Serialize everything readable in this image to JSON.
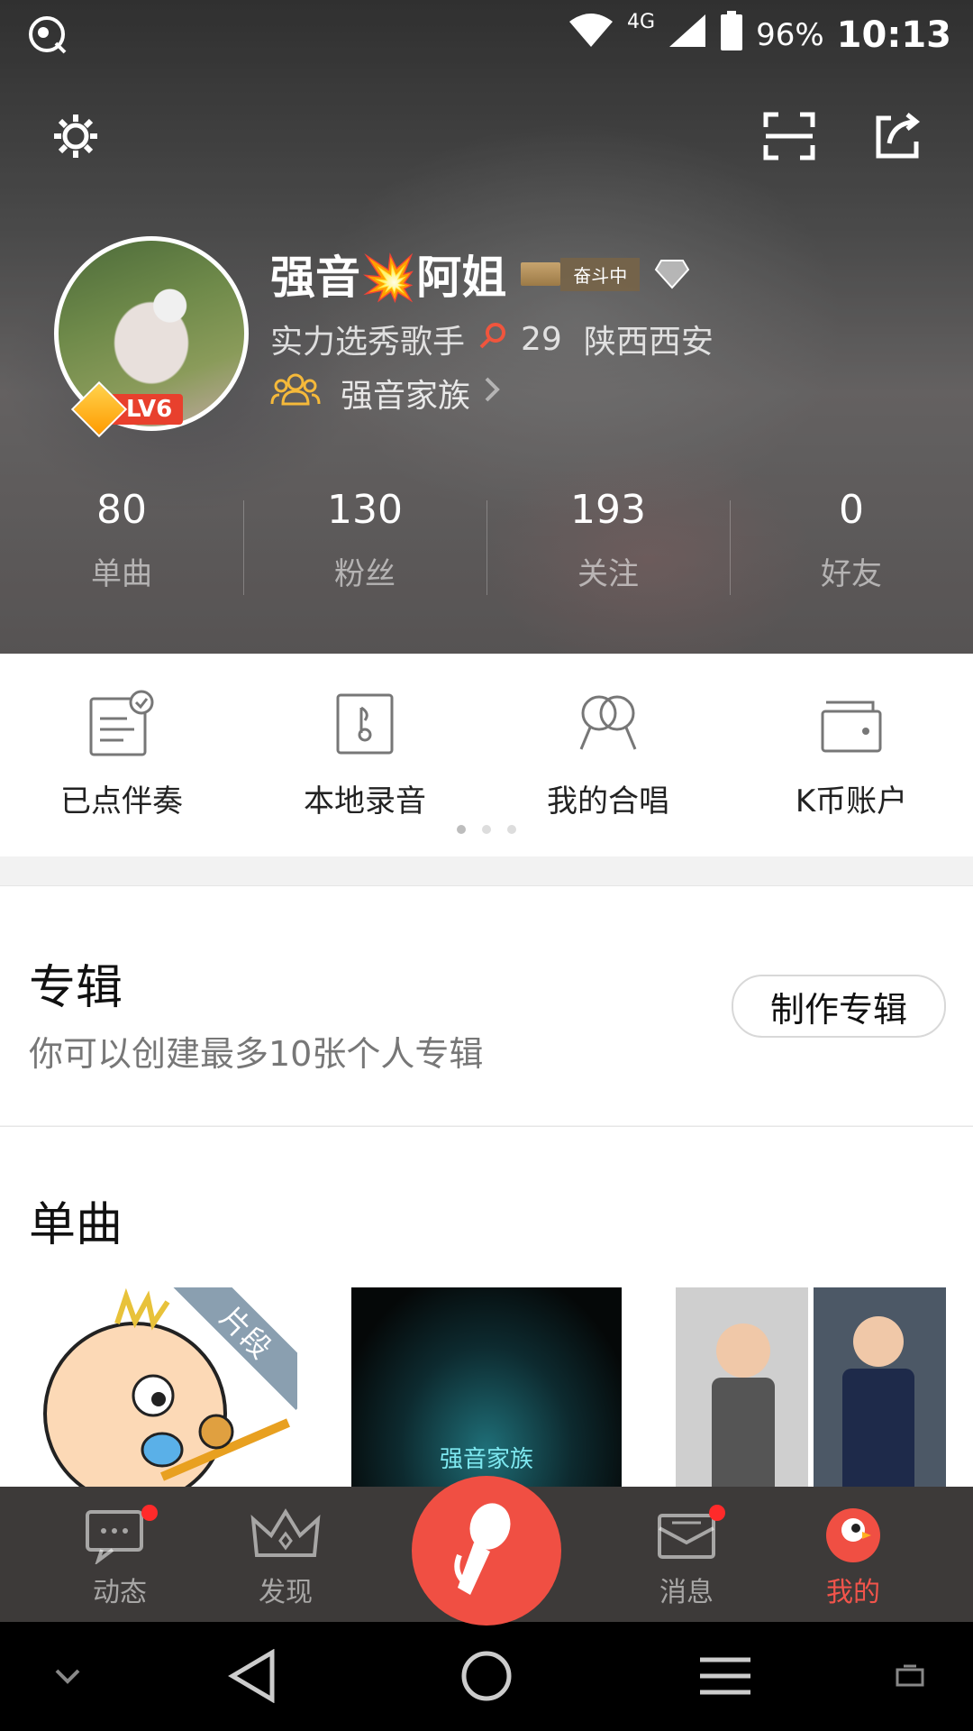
{
  "status_bar": {
    "network": "4G",
    "battery": "96%",
    "time": "10:13"
  },
  "profile": {
    "name": "强音💥阿姐",
    "status_badge": "奋斗中",
    "level": "LV6",
    "title": "实力选秀歌手",
    "age": "29",
    "location": "陕西西安",
    "family": "强音家族"
  },
  "stats": [
    {
      "value": "80",
      "label": "单曲"
    },
    {
      "value": "130",
      "label": "粉丝"
    },
    {
      "value": "193",
      "label": "关注"
    },
    {
      "value": "0",
      "label": "好友"
    }
  ],
  "quick_actions": [
    {
      "label": "已点伴奏",
      "icon": "accompaniment-list-icon"
    },
    {
      "label": "本地录音",
      "icon": "local-recording-icon"
    },
    {
      "label": "我的合唱",
      "icon": "chorus-icon"
    },
    {
      "label": "K币账户",
      "icon": "wallet-icon"
    }
  ],
  "album": {
    "title": "专辑",
    "description": "你可以创建最多10张个人专辑",
    "make_button": "制作专辑"
  },
  "singles": {
    "title": "单曲",
    "snippet_badge": "片段",
    "cover2_text": "强音家族"
  },
  "tabbar": [
    {
      "label": "动态",
      "icon": "feed-icon"
    },
    {
      "label": "发现",
      "icon": "crown-icon"
    },
    {
      "label": "消息",
      "icon": "message-icon"
    },
    {
      "label": "我的",
      "icon": "profile-icon"
    }
  ],
  "colors": {
    "accent": "#f04f43",
    "tabbar_bg": "#3d3a39",
    "family_icon": "#f5b93a"
  }
}
